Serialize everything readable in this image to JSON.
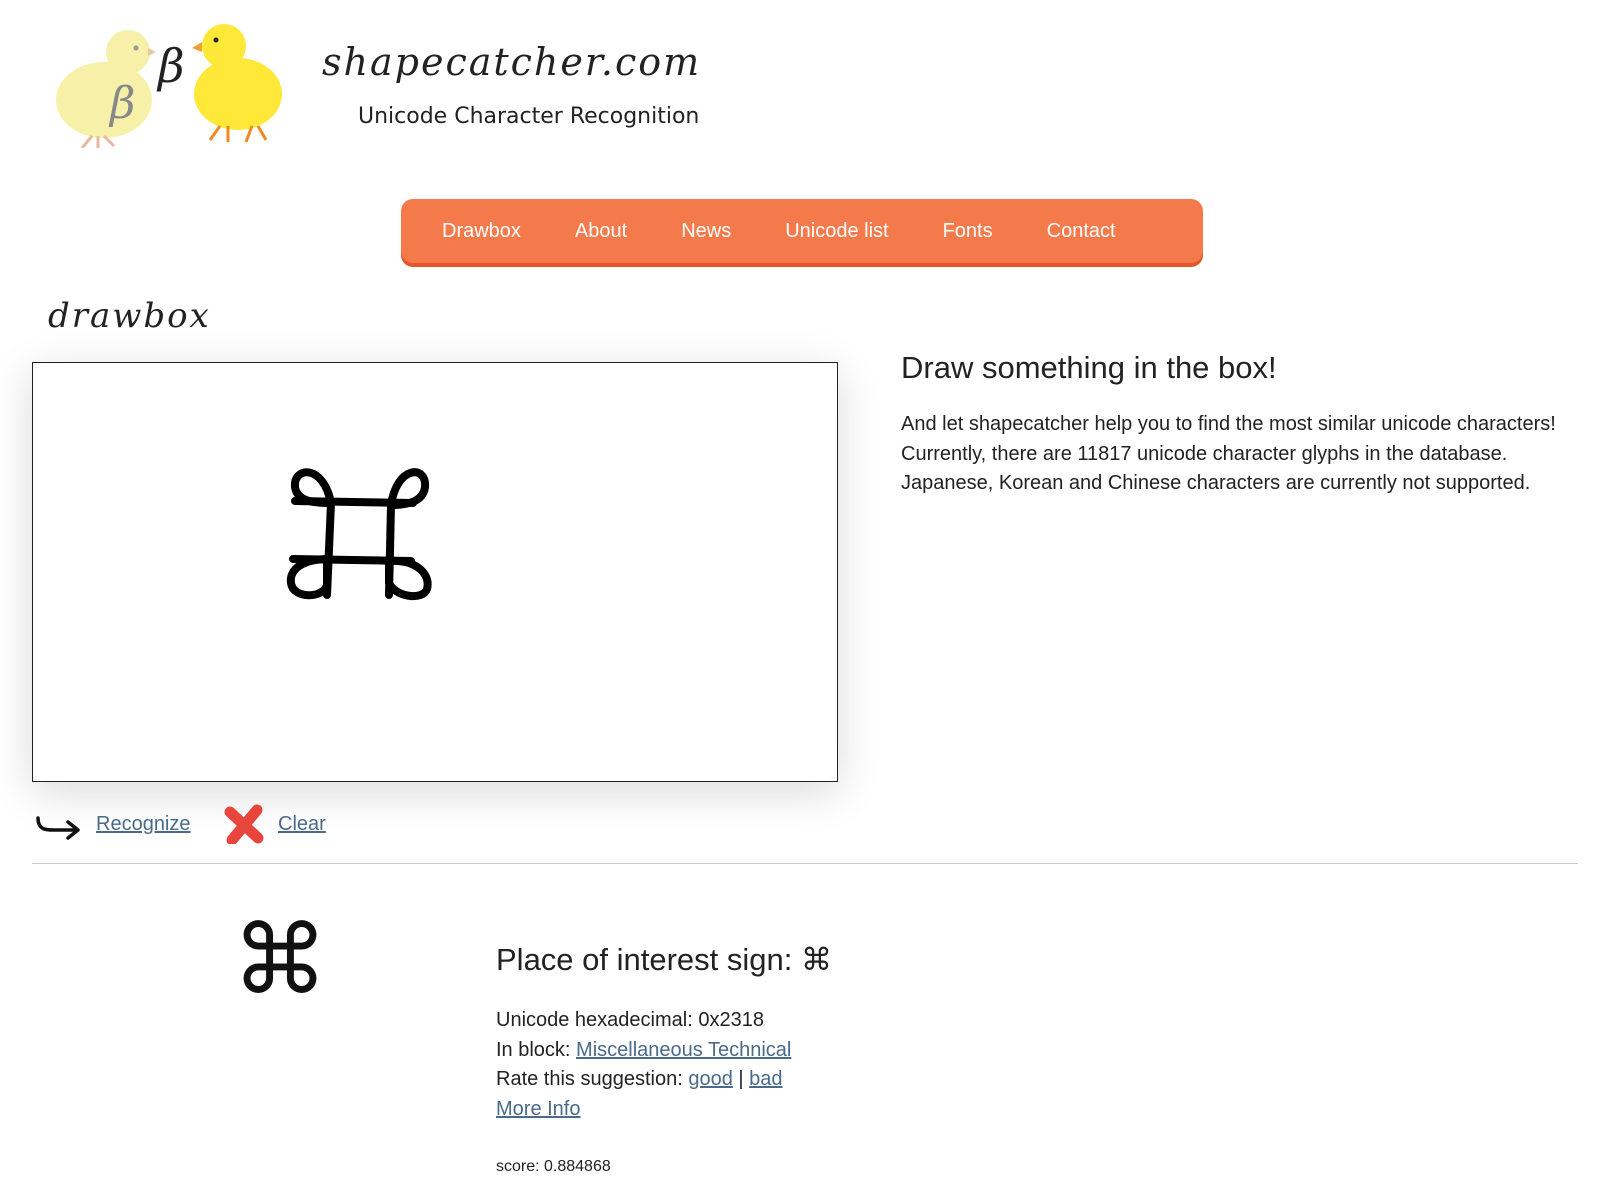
{
  "header": {
    "site_title": "shapecatcher.com",
    "subtitle": "Unicode Character Recognition",
    "logo_glyph_left": "β",
    "logo_glyph_right": "β"
  },
  "nav": {
    "items": [
      {
        "label": "Drawbox"
      },
      {
        "label": "About"
      },
      {
        "label": "News"
      },
      {
        "label": "Unicode list"
      },
      {
        "label": "Fonts"
      },
      {
        "label": "Contact"
      }
    ],
    "color": "#f47a4c"
  },
  "drawbox": {
    "title": "drawbox",
    "recognize_label": "Recognize",
    "clear_label": "Clear",
    "icons": {
      "recognize": "return-arrow-icon",
      "clear": "red-x-icon"
    }
  },
  "info": {
    "title": "Draw something in the box!",
    "line1": "And let shapecatcher help you to find the most similar unicode characters!",
    "line2": "Currently, there are 11817 unicode character glyphs in the database.",
    "line3": "Japanese, Korean and Chinese characters are currently not supported."
  },
  "result": {
    "glyph": "⌘",
    "title_prefix": "Place of interest sign: ",
    "title_glyph": "⌘",
    "hex_label": "Unicode hexadecimal: 0x2318",
    "block_label": "In block: ",
    "block_link": "Miscellaneous Technical",
    "rate_label": "Rate this suggestion: ",
    "rate_good": "good",
    "rate_sep": " | ",
    "rate_bad": "bad",
    "more_info": "More Info",
    "score": "score: 0.884868"
  },
  "colors": {
    "link": "#4a6a8a",
    "nav_bg": "#f47a4c",
    "nav_shadow": "#e4562a",
    "clear_icon": "#e8453c"
  }
}
